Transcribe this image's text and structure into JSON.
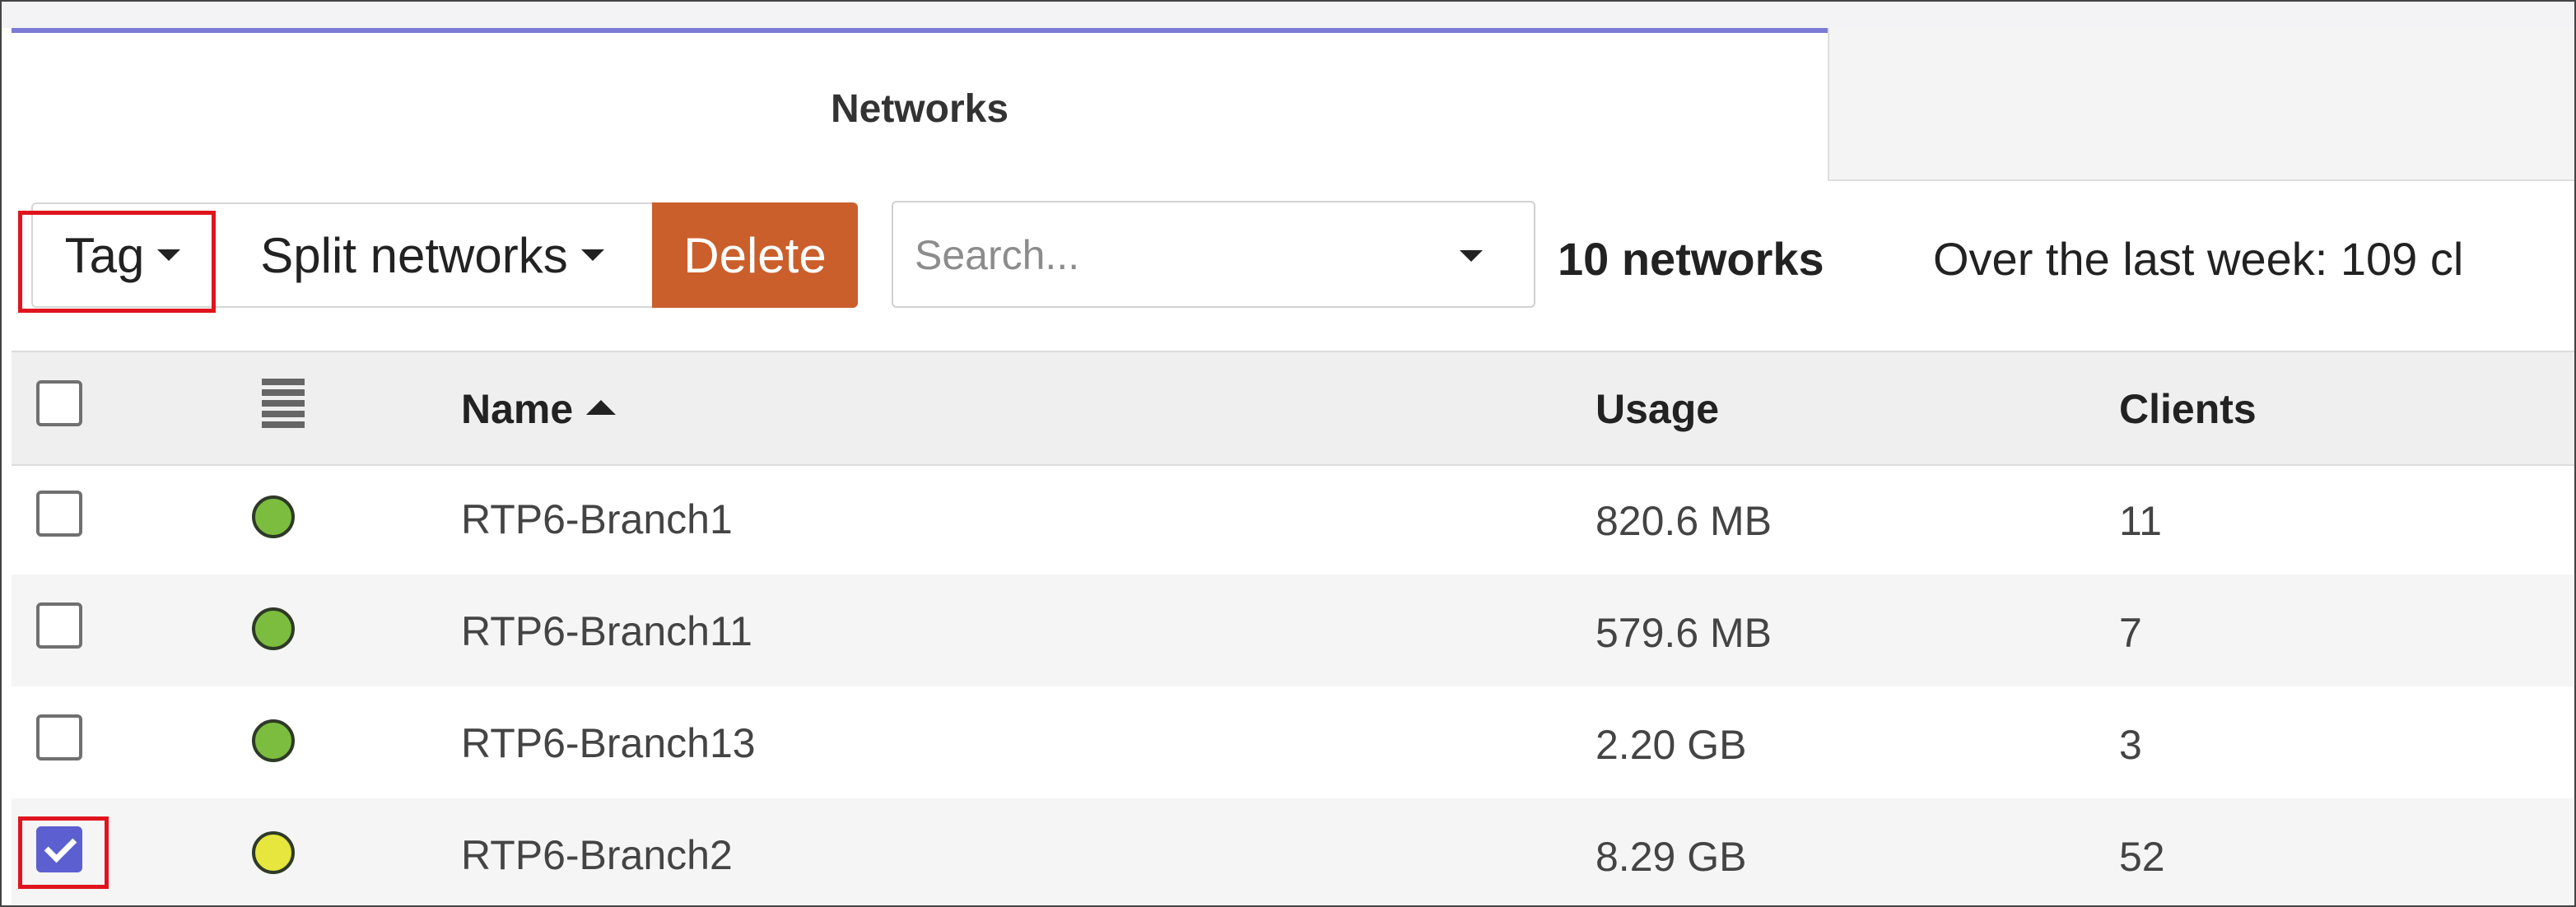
{
  "tabs": {
    "active": "Networks",
    "inactive": ""
  },
  "toolbar": {
    "tag_label": "Tag",
    "split_label": "Split networks",
    "delete_label": "Delete",
    "search_placeholder": "Search...",
    "count": "10 networks",
    "summary": "Over the last week: 109 cl"
  },
  "table": {
    "headers": {
      "name": "Name",
      "usage": "Usage",
      "clients": "Clients"
    },
    "rows": [
      {
        "name": "RTP6-Branch1",
        "usage": "820.6 MB",
        "clients": "11",
        "status": "green",
        "checked": false
      },
      {
        "name": "RTP6-Branch11",
        "usage": "579.6 MB",
        "clients": "7",
        "status": "green",
        "checked": false
      },
      {
        "name": "RTP6-Branch13",
        "usage": "2.20 GB",
        "clients": "3",
        "status": "green",
        "checked": false
      },
      {
        "name": "RTP6-Branch2",
        "usage": "8.29 GB",
        "clients": "52",
        "status": "yellow",
        "checked": true
      }
    ]
  },
  "colors": {
    "accent": "#5b5fcf",
    "delete": "#cb5f2c",
    "status_green": "#7cbd3f",
    "status_yellow": "#e6e63e",
    "highlight": "#e0141e"
  },
  "icons": {
    "tag_dropdown": "chevron-down-icon",
    "sort": "sort-ascending-icon",
    "status_column": "status-column-icon"
  }
}
